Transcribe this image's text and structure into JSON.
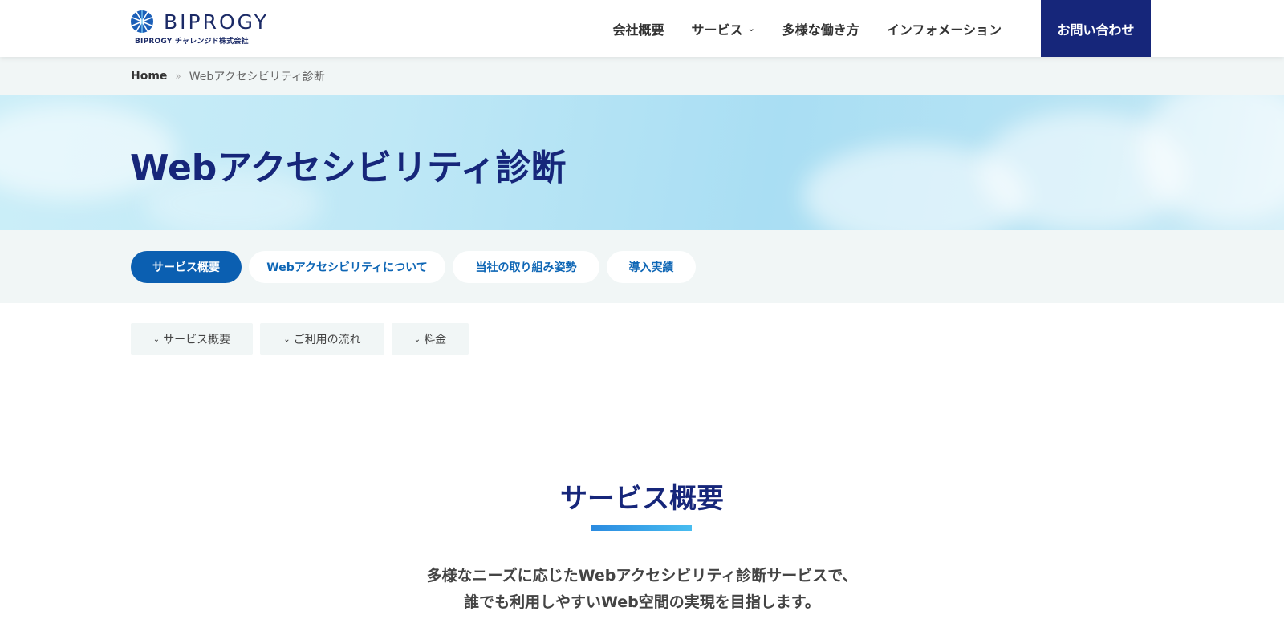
{
  "header": {
    "logo_text": "BIPROGY",
    "logo_sub": "BIPROGY チャレンジド株式会社",
    "nav": [
      {
        "label": "会社概要"
      },
      {
        "label": "サービス",
        "has_dropdown": true
      },
      {
        "label": "多様な働き方"
      },
      {
        "label": "インフォメーション"
      }
    ],
    "contact_label": "お問い合わせ"
  },
  "breadcrumb": {
    "home": "Home",
    "separator": "»",
    "current": "Webアクセシビリティ診断"
  },
  "hero": {
    "title": "Webアクセシビリティ診断"
  },
  "tabs": [
    {
      "label": "サービス概要",
      "active": true
    },
    {
      "label": "Webアクセシビリティについて",
      "active": false
    },
    {
      "label": "当社の取り組み姿勢",
      "active": false
    },
    {
      "label": "導入実績",
      "active": false
    }
  ],
  "anchors": [
    {
      "label": "サービス概要",
      "icon": "chevron-down-icon"
    },
    {
      "label": "ご利用の流れ",
      "icon": "chevron-down-icon"
    },
    {
      "label": "料金",
      "icon": "chevron-down-icon"
    }
  ],
  "section": {
    "title": "サービス概要",
    "lead_line1": "多様なニーズに応じたWebアクセシビリティ診断サービスで、",
    "lead_line2": "誰でも利用しやすいWeb空間の実現を目指します。"
  },
  "colors": {
    "brand_navy": "#16267a",
    "accent_blue": "#0b5fb1",
    "strip_bg": "#f1f6f6"
  }
}
